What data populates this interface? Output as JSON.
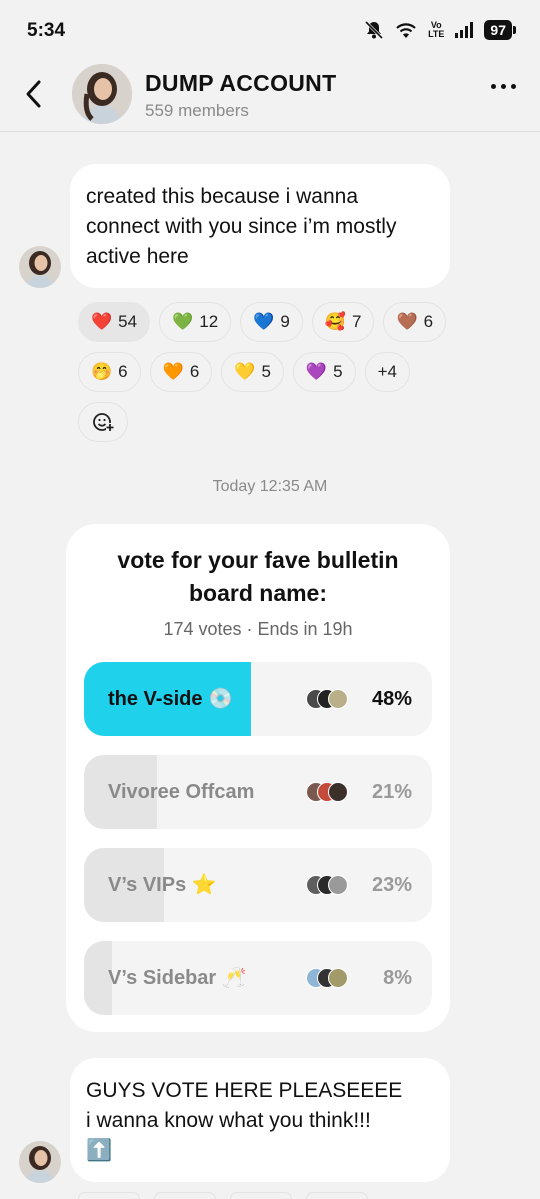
{
  "status_bar": {
    "time": "5:34",
    "volte_top": "Vo",
    "volte_bottom": "LTE",
    "battery": "97"
  },
  "header": {
    "title": "DUMP ACCOUNT",
    "members": "559 members"
  },
  "messages": [
    {
      "text": "created this because i wanna connect with you since i’m mostly active here"
    },
    {
      "text_line1": "GUYS VOTE HERE PLEASEEEE",
      "text_line2": "i wanna know what you think!!!",
      "emoji": "⬆️"
    }
  ],
  "reactions": [
    {
      "emoji": "❤️",
      "count": "54",
      "active": true
    },
    {
      "emoji": "💚",
      "count": "12"
    },
    {
      "emoji": "💙",
      "count": "9"
    },
    {
      "emoji": "🥰",
      "count": "7"
    },
    {
      "emoji": "🤎",
      "count": "6"
    },
    {
      "emoji": "🤭",
      "count": "6"
    },
    {
      "emoji": "🧡",
      "count": "6"
    },
    {
      "emoji": "💛",
      "count": "5"
    },
    {
      "emoji": "💜",
      "count": "5"
    },
    {
      "emoji": "",
      "count": "+4"
    }
  ],
  "timestamp": "Today 12:35 AM",
  "poll": {
    "question_line1": "vote for your fave bulletin",
    "question_line2": "board name:",
    "meta": "174 votes · Ends in 19h",
    "options": [
      {
        "label": "the V-side 💿",
        "percent": "48%",
        "fraction": 0.48,
        "winner": true
      },
      {
        "label": "Vivoree Offcam",
        "percent": "21%",
        "fraction": 0.21
      },
      {
        "label": "V’s VIPs ⭐",
        "percent": "23%",
        "fraction": 0.23
      },
      {
        "label": "V’s Sidebar 🥂",
        "percent": "8%",
        "fraction": 0.08
      }
    ]
  },
  "colors": {
    "accent": "#20d1eb",
    "background": "#f2f2f2",
    "bubble": "#ffffff"
  }
}
